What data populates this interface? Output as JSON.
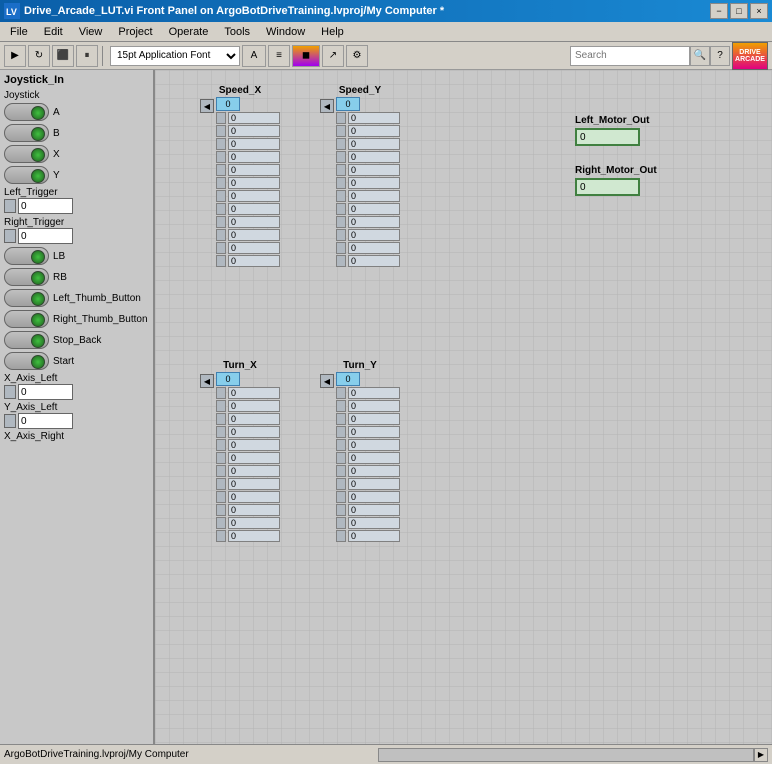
{
  "titlebar": {
    "title": "Drive_Arcade_LUT.vi Front Panel on ArgoBotDriveTraining.lvproj/My Computer *",
    "min": "−",
    "max": "□",
    "close": "×"
  },
  "menu": {
    "items": [
      "File",
      "Edit",
      "View",
      "Project",
      "Operate",
      "Tools",
      "Window",
      "Help"
    ]
  },
  "toolbar": {
    "font": "15pt Application Font",
    "search_placeholder": "Search"
  },
  "left_panel": {
    "title": "Joystick_In",
    "joystick_label": "Joystick",
    "items": [
      {
        "label": "A"
      },
      {
        "label": "B"
      },
      {
        "label": "X"
      },
      {
        "label": "Y"
      },
      {
        "label": "Left_Trigger"
      },
      {
        "label": "Right_Trigger"
      },
      {
        "label": "LB"
      },
      {
        "label": "RB"
      },
      {
        "label": "Left_Thumb_Button"
      },
      {
        "label": "Right_Thumb_Button"
      },
      {
        "label": "Stop_Back"
      },
      {
        "label": "Start"
      },
      {
        "label": "X_Axis_Left"
      },
      {
        "label": "Y_Axis_Left"
      },
      {
        "label": "X_Axis_Right"
      }
    ],
    "trigger_left_value": "0",
    "trigger_right_value": "0",
    "x_axis_left_value": "0",
    "y_axis_left_value": "0"
  },
  "speed_x": {
    "label": "Speed_X",
    "index": "0",
    "rows": [
      "0",
      "0",
      "0",
      "0",
      "0",
      "0",
      "0",
      "0",
      "0",
      "0",
      "0",
      "0"
    ]
  },
  "speed_y": {
    "label": "Speed_Y",
    "index": "0",
    "rows": [
      "0",
      "0",
      "0",
      "0",
      "0",
      "0",
      "0",
      "0",
      "0",
      "0",
      "0",
      "0"
    ]
  },
  "turn_x": {
    "label": "Turn_X",
    "index": "0",
    "rows": [
      "0",
      "0",
      "0",
      "0",
      "0",
      "0",
      "0",
      "0",
      "0",
      "0",
      "0",
      "0"
    ]
  },
  "turn_y": {
    "label": "Turn_Y",
    "index": "0",
    "rows": [
      "0",
      "0",
      "0",
      "0",
      "0",
      "0",
      "0",
      "0",
      "0",
      "0",
      "0",
      "0"
    ]
  },
  "left_motor": {
    "label": "Left_Motor_Out",
    "value": "0"
  },
  "right_motor": {
    "label": "Right_Motor_Out",
    "value": "0"
  },
  "bottom_bar": {
    "path": "ArgoBotDriveTraining.lvproj/My Computer"
  }
}
